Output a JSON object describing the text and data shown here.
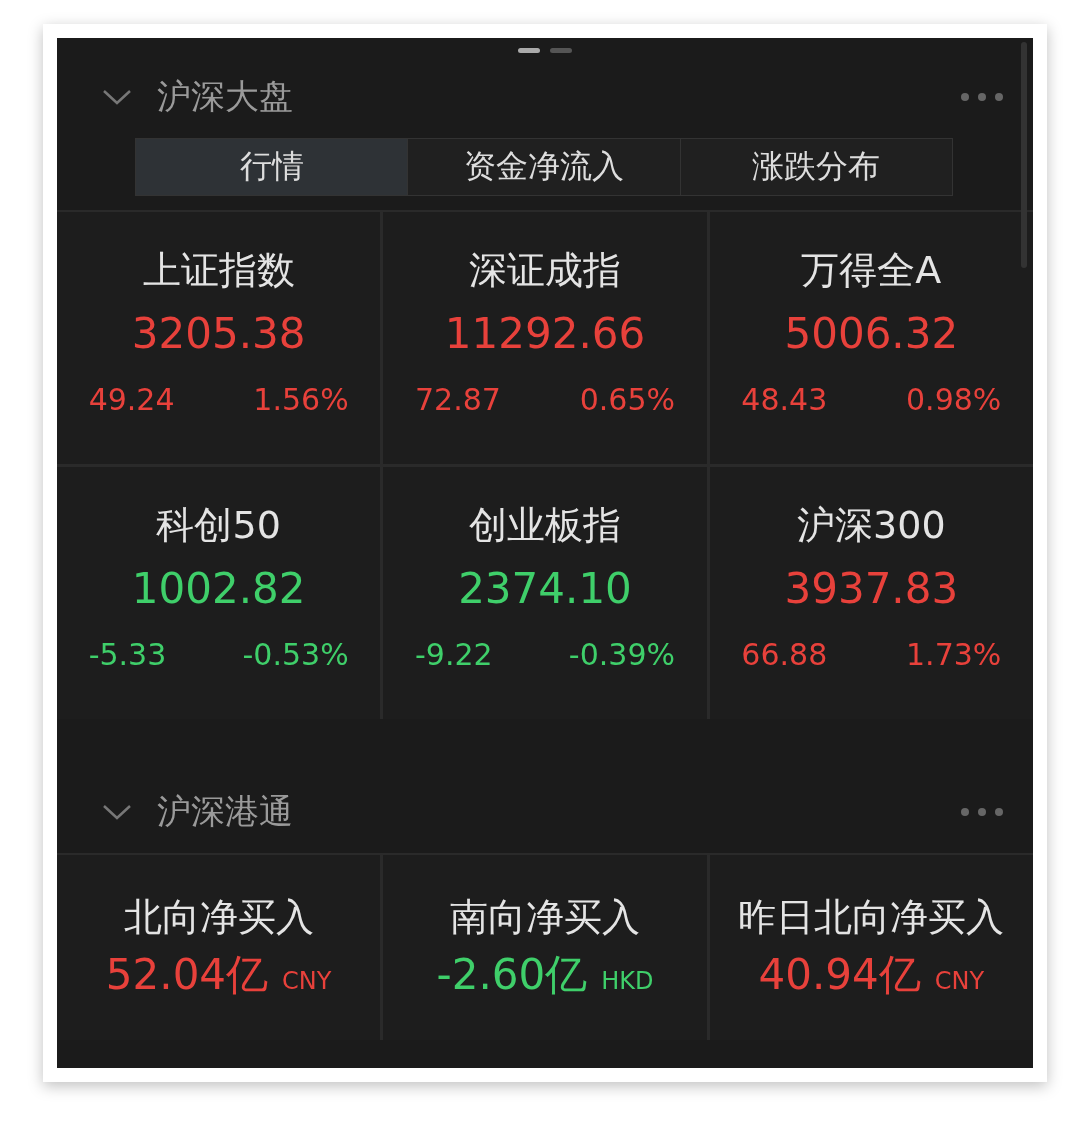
{
  "pager": [
    {
      "selected": true
    },
    {
      "selected": false
    }
  ],
  "sections": [
    {
      "title": "沪深大盘",
      "expanded": true,
      "tabs": [
        {
          "label": "行情",
          "selected": true
        },
        {
          "label": "资金净流入",
          "selected": false
        },
        {
          "label": "涨跌分布",
          "selected": false
        }
      ],
      "kind": "index",
      "cards": [
        {
          "name": "上证指数",
          "value": "3205.38",
          "change": "49.24",
          "percent": "1.56%",
          "color": "#e8413b"
        },
        {
          "name": "深证成指",
          "value": "11292.66",
          "change": "72.87",
          "percent": "0.65%",
          "color": "#e8413b"
        },
        {
          "name": "万得全A",
          "value": "5006.32",
          "change": "48.43",
          "percent": "0.98%",
          "color": "#e8413b"
        },
        {
          "name": "科创50",
          "value": "1002.82",
          "change": "-5.33",
          "percent": "-0.53%",
          "color": "#3fcf6a"
        },
        {
          "name": "创业板指",
          "value": "2374.10",
          "change": "-9.22",
          "percent": "-0.39%",
          "color": "#3fcf6a"
        },
        {
          "name": "沪深300",
          "value": "3937.83",
          "change": "66.88",
          "percent": "1.73%",
          "color": "#e8413b"
        }
      ]
    },
    {
      "title": "沪深港通",
      "expanded": true,
      "kind": "flow",
      "cards": [
        {
          "name": "北向净买入",
          "value": "52.04亿",
          "currency": "CNY",
          "color": "#e8413b"
        },
        {
          "name": "南向净买入",
          "value": "-2.60亿",
          "currency": "HKD",
          "color": "#3fcf6a"
        },
        {
          "name": "昨日北向净买入",
          "value": "40.94亿",
          "currency": "CNY",
          "color": "#e8413b"
        }
      ]
    }
  ]
}
